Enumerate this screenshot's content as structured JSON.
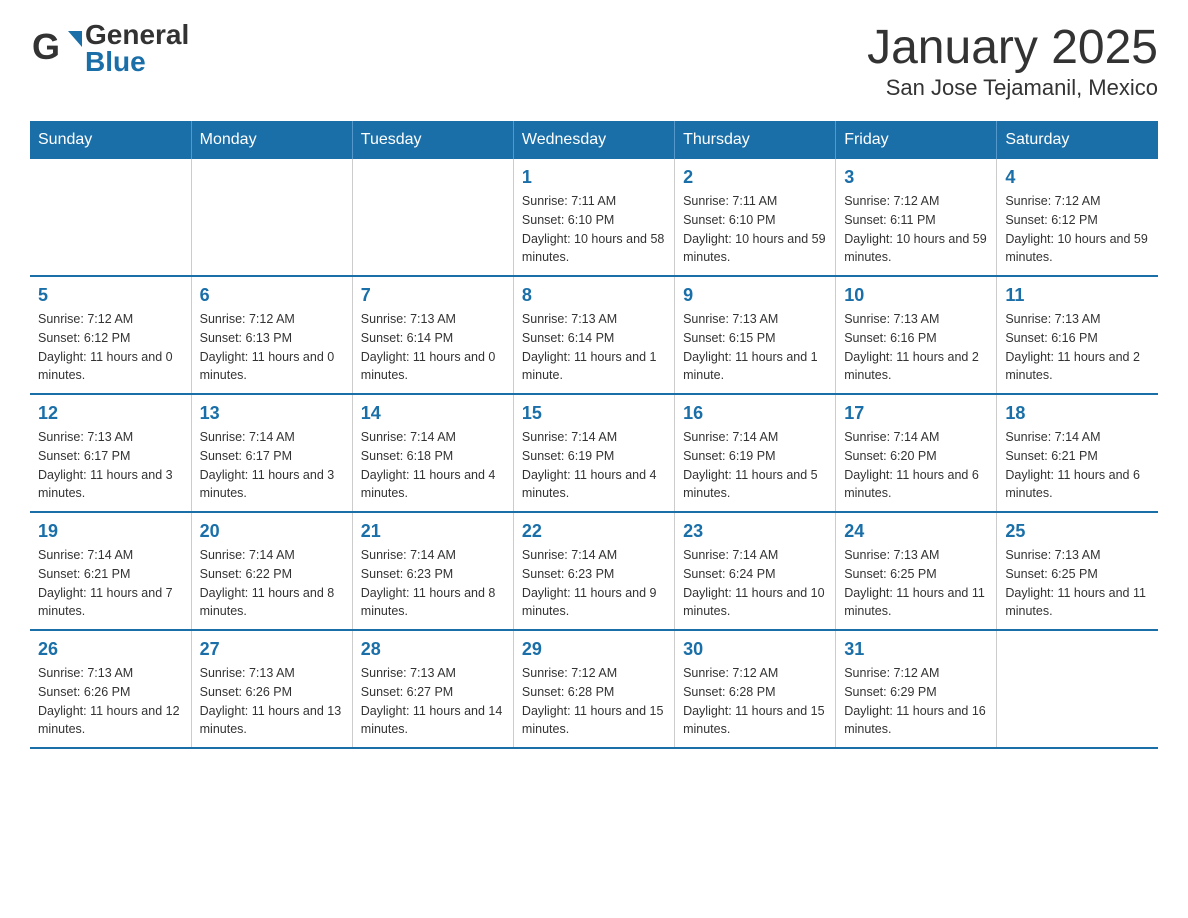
{
  "header": {
    "logo": {
      "general": "General",
      "blue": "Blue"
    },
    "title": "January 2025",
    "subtitle": "San Jose Tejamanil, Mexico"
  },
  "calendar": {
    "weekdays": [
      "Sunday",
      "Monday",
      "Tuesday",
      "Wednesday",
      "Thursday",
      "Friday",
      "Saturday"
    ],
    "weeks": [
      [
        {
          "day": "",
          "sunrise": "",
          "sunset": "",
          "daylight": ""
        },
        {
          "day": "",
          "sunrise": "",
          "sunset": "",
          "daylight": ""
        },
        {
          "day": "",
          "sunrise": "",
          "sunset": "",
          "daylight": ""
        },
        {
          "day": "1",
          "sunrise": "Sunrise: 7:11 AM",
          "sunset": "Sunset: 6:10 PM",
          "daylight": "Daylight: 10 hours and 58 minutes."
        },
        {
          "day": "2",
          "sunrise": "Sunrise: 7:11 AM",
          "sunset": "Sunset: 6:10 PM",
          "daylight": "Daylight: 10 hours and 59 minutes."
        },
        {
          "day": "3",
          "sunrise": "Sunrise: 7:12 AM",
          "sunset": "Sunset: 6:11 PM",
          "daylight": "Daylight: 10 hours and 59 minutes."
        },
        {
          "day": "4",
          "sunrise": "Sunrise: 7:12 AM",
          "sunset": "Sunset: 6:12 PM",
          "daylight": "Daylight: 10 hours and 59 minutes."
        }
      ],
      [
        {
          "day": "5",
          "sunrise": "Sunrise: 7:12 AM",
          "sunset": "Sunset: 6:12 PM",
          "daylight": "Daylight: 11 hours and 0 minutes."
        },
        {
          "day": "6",
          "sunrise": "Sunrise: 7:12 AM",
          "sunset": "Sunset: 6:13 PM",
          "daylight": "Daylight: 11 hours and 0 minutes."
        },
        {
          "day": "7",
          "sunrise": "Sunrise: 7:13 AM",
          "sunset": "Sunset: 6:14 PM",
          "daylight": "Daylight: 11 hours and 0 minutes."
        },
        {
          "day": "8",
          "sunrise": "Sunrise: 7:13 AM",
          "sunset": "Sunset: 6:14 PM",
          "daylight": "Daylight: 11 hours and 1 minute."
        },
        {
          "day": "9",
          "sunrise": "Sunrise: 7:13 AM",
          "sunset": "Sunset: 6:15 PM",
          "daylight": "Daylight: 11 hours and 1 minute."
        },
        {
          "day": "10",
          "sunrise": "Sunrise: 7:13 AM",
          "sunset": "Sunset: 6:16 PM",
          "daylight": "Daylight: 11 hours and 2 minutes."
        },
        {
          "day": "11",
          "sunrise": "Sunrise: 7:13 AM",
          "sunset": "Sunset: 6:16 PM",
          "daylight": "Daylight: 11 hours and 2 minutes."
        }
      ],
      [
        {
          "day": "12",
          "sunrise": "Sunrise: 7:13 AM",
          "sunset": "Sunset: 6:17 PM",
          "daylight": "Daylight: 11 hours and 3 minutes."
        },
        {
          "day": "13",
          "sunrise": "Sunrise: 7:14 AM",
          "sunset": "Sunset: 6:17 PM",
          "daylight": "Daylight: 11 hours and 3 minutes."
        },
        {
          "day": "14",
          "sunrise": "Sunrise: 7:14 AM",
          "sunset": "Sunset: 6:18 PM",
          "daylight": "Daylight: 11 hours and 4 minutes."
        },
        {
          "day": "15",
          "sunrise": "Sunrise: 7:14 AM",
          "sunset": "Sunset: 6:19 PM",
          "daylight": "Daylight: 11 hours and 4 minutes."
        },
        {
          "day": "16",
          "sunrise": "Sunrise: 7:14 AM",
          "sunset": "Sunset: 6:19 PM",
          "daylight": "Daylight: 11 hours and 5 minutes."
        },
        {
          "day": "17",
          "sunrise": "Sunrise: 7:14 AM",
          "sunset": "Sunset: 6:20 PM",
          "daylight": "Daylight: 11 hours and 6 minutes."
        },
        {
          "day": "18",
          "sunrise": "Sunrise: 7:14 AM",
          "sunset": "Sunset: 6:21 PM",
          "daylight": "Daylight: 11 hours and 6 minutes."
        }
      ],
      [
        {
          "day": "19",
          "sunrise": "Sunrise: 7:14 AM",
          "sunset": "Sunset: 6:21 PM",
          "daylight": "Daylight: 11 hours and 7 minutes."
        },
        {
          "day": "20",
          "sunrise": "Sunrise: 7:14 AM",
          "sunset": "Sunset: 6:22 PM",
          "daylight": "Daylight: 11 hours and 8 minutes."
        },
        {
          "day": "21",
          "sunrise": "Sunrise: 7:14 AM",
          "sunset": "Sunset: 6:23 PM",
          "daylight": "Daylight: 11 hours and 8 minutes."
        },
        {
          "day": "22",
          "sunrise": "Sunrise: 7:14 AM",
          "sunset": "Sunset: 6:23 PM",
          "daylight": "Daylight: 11 hours and 9 minutes."
        },
        {
          "day": "23",
          "sunrise": "Sunrise: 7:14 AM",
          "sunset": "Sunset: 6:24 PM",
          "daylight": "Daylight: 11 hours and 10 minutes."
        },
        {
          "day": "24",
          "sunrise": "Sunrise: 7:13 AM",
          "sunset": "Sunset: 6:25 PM",
          "daylight": "Daylight: 11 hours and 11 minutes."
        },
        {
          "day": "25",
          "sunrise": "Sunrise: 7:13 AM",
          "sunset": "Sunset: 6:25 PM",
          "daylight": "Daylight: 11 hours and 11 minutes."
        }
      ],
      [
        {
          "day": "26",
          "sunrise": "Sunrise: 7:13 AM",
          "sunset": "Sunset: 6:26 PM",
          "daylight": "Daylight: 11 hours and 12 minutes."
        },
        {
          "day": "27",
          "sunrise": "Sunrise: 7:13 AM",
          "sunset": "Sunset: 6:26 PM",
          "daylight": "Daylight: 11 hours and 13 minutes."
        },
        {
          "day": "28",
          "sunrise": "Sunrise: 7:13 AM",
          "sunset": "Sunset: 6:27 PM",
          "daylight": "Daylight: 11 hours and 14 minutes."
        },
        {
          "day": "29",
          "sunrise": "Sunrise: 7:12 AM",
          "sunset": "Sunset: 6:28 PM",
          "daylight": "Daylight: 11 hours and 15 minutes."
        },
        {
          "day": "30",
          "sunrise": "Sunrise: 7:12 AM",
          "sunset": "Sunset: 6:28 PM",
          "daylight": "Daylight: 11 hours and 15 minutes."
        },
        {
          "day": "31",
          "sunrise": "Sunrise: 7:12 AM",
          "sunset": "Sunset: 6:29 PM",
          "daylight": "Daylight: 11 hours and 16 minutes."
        },
        {
          "day": "",
          "sunrise": "",
          "sunset": "",
          "daylight": ""
        }
      ]
    ]
  }
}
